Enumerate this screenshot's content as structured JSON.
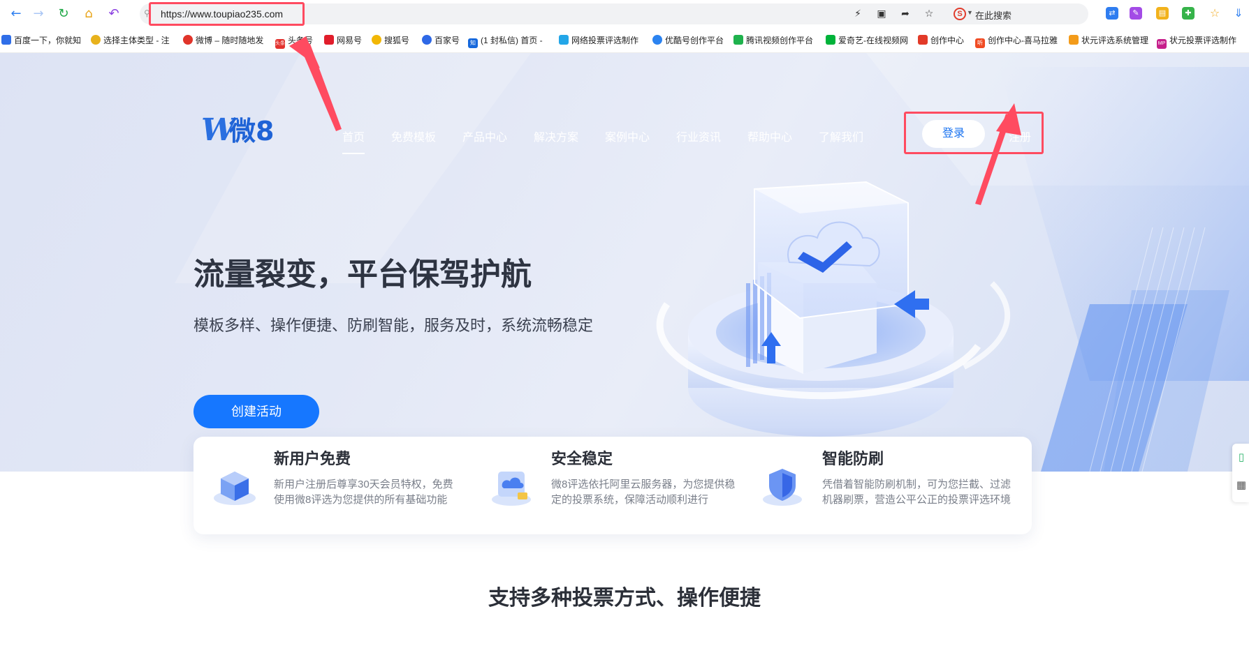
{
  "browser": {
    "url": "https://www.toupiao235.com",
    "search_label": "在此搜索",
    "search_engine_letter": "S",
    "nav_icons": [
      "back-arrow-icon",
      "forward-arrow-icon",
      "refresh-icon",
      "home-icon",
      "undo-icon"
    ],
    "toolbar_icons": [
      "lightning-icon",
      "screenshot-icon",
      "share-icon",
      "star-outline-icon"
    ],
    "extension_icons": [
      "translate-icon",
      "edit-icon",
      "folder-icon",
      "puzzle-icon",
      "star-icon",
      "download-icon"
    ]
  },
  "bookmarks": [
    {
      "label": "百度一下，你就知",
      "icon": "baidu-icon",
      "color": "#2f6ee8"
    },
    {
      "label": "选择主体类型 - 注",
      "icon": "bell-icon",
      "color": "#e8b21c"
    },
    {
      "label": "微博 – 随时随地发",
      "icon": "weibo-icon",
      "color": "#e0342a"
    },
    {
      "label": "头条号",
      "icon": "toutiao-icon",
      "color": "#e3332f",
      "badge": "头条"
    },
    {
      "label": "网易号",
      "icon": "netease-icon",
      "color": "#e11d2b"
    },
    {
      "label": "搜狐号",
      "icon": "sohu-icon",
      "color": "#f2b705"
    },
    {
      "label": "百家号",
      "icon": "baijia-icon",
      "color": "#2e68e6"
    },
    {
      "label": "(1 封私信) 首页 -",
      "icon": "zhihu-icon",
      "color": "#1668dc",
      "badge": "知"
    },
    {
      "label": "网络投票评选制作",
      "icon": "bilibili-icon",
      "color": "#23a6e8"
    },
    {
      "label": "优酷号创作平台",
      "icon": "youku-icon",
      "color": "#2b83f0"
    },
    {
      "label": "腾讯视频创作平台",
      "icon": "tencent-video-icon",
      "color": "#1fb24d"
    },
    {
      "label": "爱奇艺-在线视频网",
      "icon": "iqiyi-icon",
      "color": "#00b33a"
    },
    {
      "label": "创作中心",
      "icon": "creator-icon",
      "color": "#e23a28"
    },
    {
      "label": "创作中心-喜马拉雅",
      "icon": "ximalaya-icon",
      "color": "#f04b23",
      "badge": "听"
    },
    {
      "label": "状元评选系统管理",
      "icon": "box-icon",
      "color": "#f39b1a"
    },
    {
      "label": "状元投票评选制作",
      "icon": "mp-icon",
      "color": "#c61f8b",
      "badge": "MP"
    }
  ],
  "site": {
    "logo_mark": "W",
    "logo_text": "微8",
    "nav": [
      "首页",
      "免费模板",
      "产品中心",
      "解决方案",
      "案例中心",
      "行业资讯",
      "帮助中心",
      "了解我们"
    ],
    "login": "登录",
    "register": "注册"
  },
  "hero": {
    "title": "流量裂变，平台保驾护航",
    "subtitle": "模板多样、操作便捷、防刷智能，服务及时，系统流畅稳定",
    "cta": "创建活动"
  },
  "features": [
    {
      "title": "新用户免费",
      "desc": "新用户注册后尊享30天会员特权，免费使用微8评选为您提供的所有基础功能",
      "icon": "cube-stack-icon"
    },
    {
      "title": "安全稳定",
      "desc": "微8评选依托阿里云服务器，为您提供稳定的投票系统，保障活动顺利进行",
      "icon": "cloud-shield-icon"
    },
    {
      "title": "智能防刷",
      "desc": "凭借着智能防刷机制，可为您拦截、过滤机器刷票，营造公平公正的投票评选环境",
      "icon": "shield-check-icon"
    }
  ],
  "section": {
    "title": "支持多种投票方式、操作便捷"
  },
  "colors": {
    "primary": "#1677ff",
    "annotation": "#ff4b60",
    "title_text": "#2e3442"
  }
}
